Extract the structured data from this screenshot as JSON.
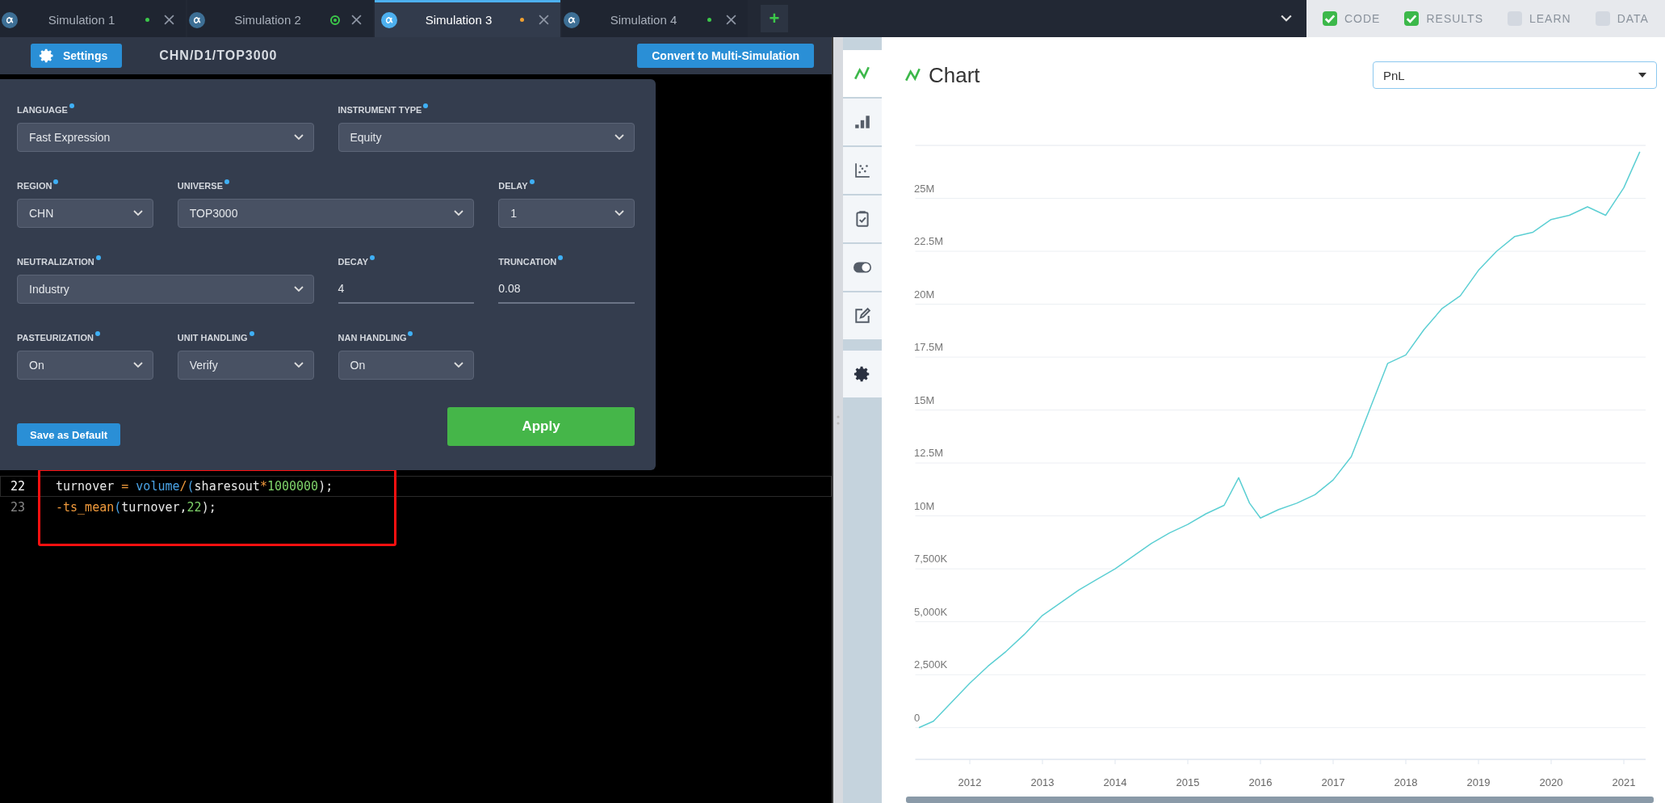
{
  "tabs": [
    {
      "label": "Simulation 1",
      "selected": false,
      "status": {
        "kind": "dot",
        "color": "#3cc84a"
      }
    },
    {
      "label": "Simulation 2",
      "selected": false,
      "status": {
        "kind": "ring",
        "color": "#3cc84a"
      }
    },
    {
      "label": "Simulation 3",
      "selected": true,
      "status": {
        "kind": "dot",
        "color": "#f0a030"
      }
    },
    {
      "label": "Simulation 4",
      "selected": false,
      "status": {
        "kind": "dot",
        "color": "#3cc84a"
      }
    }
  ],
  "add_tab": "+",
  "panels": [
    {
      "label": "CODE",
      "checked": true
    },
    {
      "label": "RESULTS",
      "checked": true
    },
    {
      "label": "LEARN",
      "checked": false
    },
    {
      "label": "DATA",
      "checked": false
    }
  ],
  "toolbar": {
    "settings_button": "Settings",
    "path": "CHN/D1/TOP3000",
    "convert_button": "Convert to Multi-Simulation"
  },
  "settings": {
    "fields": [
      {
        "label": "LANGUAGE",
        "required": true,
        "kind": "select",
        "value": "Fast Expression"
      },
      {
        "label": "INSTRUMENT TYPE",
        "required": true,
        "kind": "select",
        "value": "Equity"
      },
      {
        "label": "REGION",
        "required": true,
        "kind": "select",
        "value": "CHN"
      },
      {
        "label": "UNIVERSE",
        "required": true,
        "kind": "select",
        "value": "TOP3000"
      },
      {
        "label": "DELAY",
        "required": true,
        "kind": "select",
        "value": "1"
      },
      {
        "label": "NEUTRALIZATION",
        "required": true,
        "kind": "select",
        "value": "Industry"
      },
      {
        "label": "DECAY",
        "required": true,
        "kind": "input",
        "value": "4"
      },
      {
        "label": "TRUNCATION",
        "required": true,
        "kind": "input",
        "value": "0.08"
      },
      {
        "label": "PASTEURIZATION",
        "required": true,
        "kind": "select",
        "value": "On"
      },
      {
        "label": "UNIT HANDLING",
        "required": true,
        "kind": "select",
        "value": "Verify"
      },
      {
        "label": "NAN HANDLING",
        "required": true,
        "kind": "select",
        "value": "On"
      }
    ],
    "save_default": "Save as Default",
    "apply": "Apply"
  },
  "code": {
    "lines": [
      {
        "number": "22",
        "current": true,
        "tokens": [
          {
            "kind": "ident",
            "text": "turnover"
          },
          {
            "kind": "op",
            "text": " = "
          },
          {
            "kind": "func",
            "text": "volume"
          },
          {
            "kind": "op",
            "text": "/"
          },
          {
            "kind": "func",
            "text": "("
          },
          {
            "kind": "ident",
            "text": "sharesout"
          },
          {
            "kind": "op",
            "text": "*"
          },
          {
            "kind": "num",
            "text": "1000000"
          },
          {
            "kind": "ident",
            "text": ");"
          }
        ]
      },
      {
        "number": "23",
        "current": false,
        "tokens": [
          {
            "kind": "op",
            "text": "-ts_mean"
          },
          {
            "kind": "func",
            "text": "("
          },
          {
            "kind": "ident",
            "text": "turnover,"
          },
          {
            "kind": "num",
            "text": "22"
          },
          {
            "kind": "ident",
            "text": ");"
          }
        ]
      }
    ]
  },
  "results_nav": [
    {
      "kind": "line-chart",
      "selected": true
    },
    {
      "kind": "bar-chart",
      "selected": false
    },
    {
      "kind": "scatter",
      "selected": false
    },
    {
      "kind": "clipboard",
      "selected": false
    },
    {
      "kind": "toggle",
      "selected": false
    },
    {
      "kind": "edit",
      "selected": false
    },
    {
      "kind": "settings",
      "selected": false
    }
  ],
  "chart": {
    "title": "Chart",
    "metric": "PnL",
    "chart_data": {
      "type": "line",
      "grid": true,
      "x": [
        2011.3,
        2011.5,
        2011.75,
        2012.0,
        2012.25,
        2012.5,
        2012.75,
        2013.0,
        2013.25,
        2013.5,
        2013.75,
        2014.0,
        2014.25,
        2014.5,
        2014.75,
        2015.0,
        2015.25,
        2015.5,
        2015.7,
        2015.85,
        2016.0,
        2016.25,
        2016.5,
        2016.75,
        2017.0,
        2017.25,
        2017.5,
        2017.75,
        2018.0,
        2018.25,
        2018.5,
        2018.75,
        2019.0,
        2019.25,
        2019.5,
        2019.75,
        2020.0,
        2020.25,
        2020.5,
        2020.75,
        2021.0,
        2021.22
      ],
      "series": [
        {
          "color": "#5ccfd3",
          "values": [
            0,
            300000,
            1200000,
            2100000,
            2900000,
            3600000,
            4400000,
            5300000,
            5900000,
            6500000,
            7000000,
            7500000,
            8100000,
            8700000,
            9200000,
            9600000,
            10100000,
            10500000,
            11800000,
            10600000,
            9900000,
            10300000,
            10600000,
            11000000,
            11700000,
            12800000,
            15000000,
            17200000,
            17600000,
            18800000,
            19800000,
            20400000,
            21600000,
            22500000,
            23200000,
            23400000,
            24000000,
            24200000,
            24600000,
            24200000,
            25500000,
            27200000
          ]
        }
      ],
      "xlim": [
        2011.25,
        2021.3
      ],
      "ylim": [
        -1500000,
        27500000
      ],
      "xticks": [
        2012,
        2013,
        2014,
        2015,
        2016,
        2017,
        2018,
        2019,
        2020,
        2021
      ],
      "yticks": [
        {
          "value": 0,
          "label": "0"
        },
        {
          "value": 2500000,
          "label": "2,500K"
        },
        {
          "value": 5000000,
          "label": "5,000K"
        },
        {
          "value": 7500000,
          "label": "7,500K"
        },
        {
          "value": 10000000,
          "label": "10M"
        },
        {
          "value": 12500000,
          "label": "12.5M"
        },
        {
          "value": 15000000,
          "label": "15M"
        },
        {
          "value": 17500000,
          "label": "17.5M"
        },
        {
          "value": 20000000,
          "label": "20M"
        },
        {
          "value": 22500000,
          "label": "22.5M"
        },
        {
          "value": 25000000,
          "label": "25M"
        }
      ]
    }
  }
}
